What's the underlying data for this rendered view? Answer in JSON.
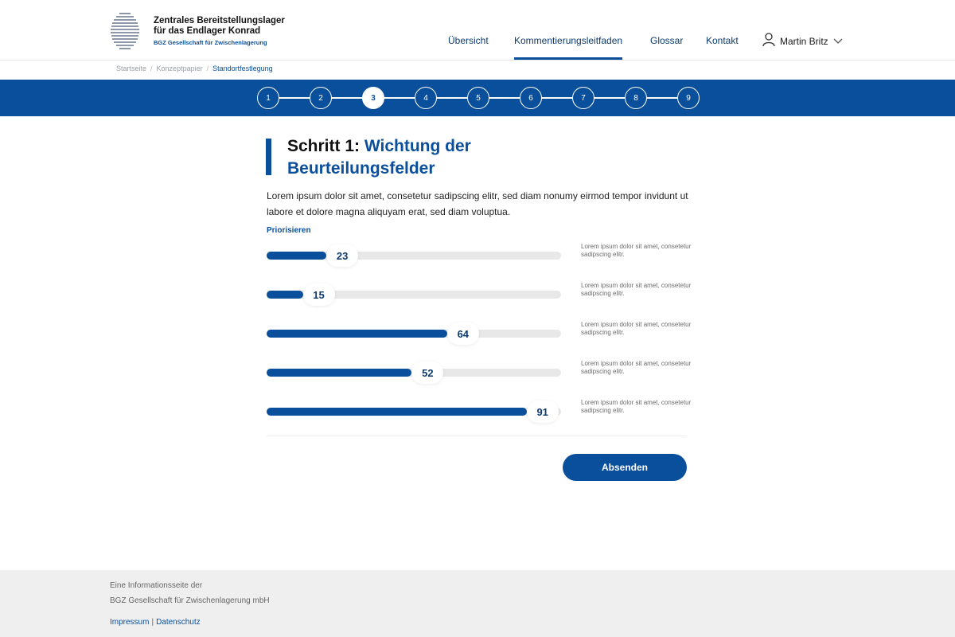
{
  "header": {
    "logo_line1": "Zentrales Bereitstellungslager",
    "logo_line2": "für das Endlager Konrad",
    "logo_line3": "BGZ Gesellschaft für Zwischenlagerung",
    "nav": [
      "Übersicht",
      "Kommentierungsleitfaden",
      "Glossar",
      "Kontakt"
    ],
    "active_nav": "Kommentierungsleitfaden",
    "user_name": "Martin Britz"
  },
  "breadcrumb": [
    "Startseite",
    "Konzeptpapier",
    "Standortfestlegung"
  ],
  "stepper": {
    "steps": [
      "1",
      "2",
      "3",
      "4",
      "5",
      "6",
      "7",
      "8",
      "9"
    ],
    "active_step": "3"
  },
  "main": {
    "title_prefix": "Schritt 1:",
    "title_highlight": "Wichtung der Beurteilungsfelder",
    "intro": "Lorem ipsum dolor sit amet, consetetur sadipscing elitr, sed diam nonumy eirmod tempor invidunt ut labore et dolore magna aliquyam erat, sed diam voluptua.",
    "section_label": "Priorisieren",
    "sliders": [
      {
        "value": 23,
        "description": "Lorem ipsum dolor sit amet, consetetur sadipscing elitr."
      },
      {
        "value": 15,
        "description": "Lorem ipsum dolor sit amet, consetetur sadipscing elitr."
      },
      {
        "value": 64,
        "description": "Lorem ipsum dolor sit amet, consetetur sadipscing elitr."
      },
      {
        "value": 52,
        "description": "Lorem ipsum dolor sit amet, consetetur sadipscing elitr."
      },
      {
        "value": 91,
        "description": "Lorem ipsum dolor sit amet, consetetur sadipscing elitr."
      }
    ],
    "slider_max": 100,
    "submit_label": "Absenden"
  },
  "footer": {
    "line1": "Eine Informationsseite der",
    "line2": "BGZ Gesellschaft für Zwischenlagerung mbH",
    "impressum": "Impressum",
    "datenschutz": "Datenschutz"
  },
  "colors": {
    "primary": "#0a4f9c",
    "footer_bg": "#efefef",
    "track": "#e8e8e8"
  }
}
